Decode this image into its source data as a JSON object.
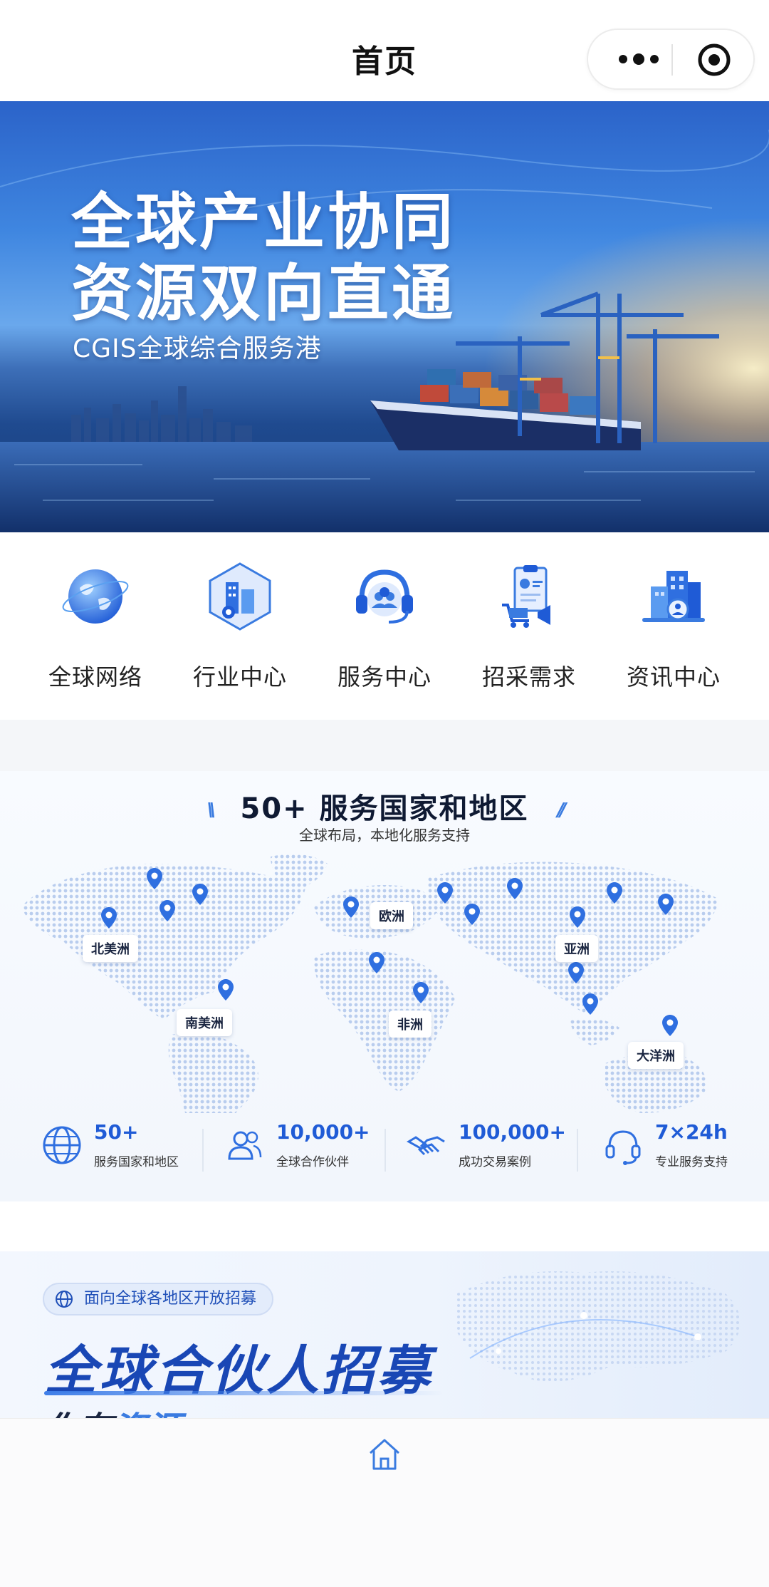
{
  "header": {
    "title": "首页"
  },
  "banner": {
    "title_line1": "全球产业协同",
    "title_line2": "资源双向直通",
    "subtitle": "CGIS全球综合服务港"
  },
  "nav": {
    "items": [
      {
        "label": "全球网络",
        "icon": "globe-icon"
      },
      {
        "label": "行业中心",
        "icon": "industry-building-icon"
      },
      {
        "label": "服务中心",
        "icon": "headset-service-icon"
      },
      {
        "label": "招采需求",
        "icon": "procurement-clipboard-icon"
      },
      {
        "label": "资讯中心",
        "icon": "news-building-icon"
      }
    ]
  },
  "map_section": {
    "title": "50+ 服务国家和地区",
    "subtitle": "全球布局，本地化服务支持",
    "regions": [
      "北美洲",
      "南美洲",
      "欧洲",
      "非洲",
      "亚洲",
      "大洋洲"
    ],
    "stats": [
      {
        "value": "50+",
        "label": "服务国家和地区",
        "icon": "globe-icon"
      },
      {
        "value": "10,000+",
        "label": "全球合作伙伴",
        "icon": "users-icon"
      },
      {
        "value": "100,000+",
        "label": "成功交易案例",
        "icon": "handshake-icon"
      },
      {
        "value": "7×24h",
        "label": "专业服务支持",
        "icon": "headset-icon"
      }
    ]
  },
  "recruit": {
    "badge": "面向全球各地区开放招募",
    "title": "全球合伙人招募",
    "sub_prefix": "你有",
    "sub_accent": "资源"
  },
  "colors": {
    "accent": "#1f5bd6",
    "brand_dark": "#1947b5"
  }
}
